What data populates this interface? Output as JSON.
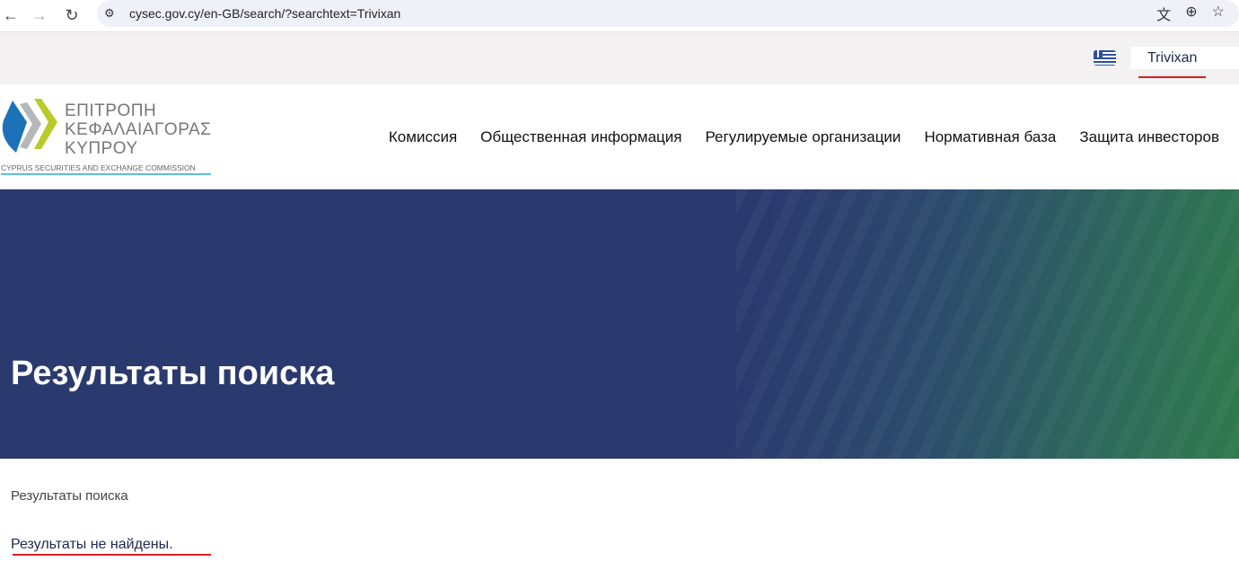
{
  "browser": {
    "url": "cysec.gov.cy/en-GB/search/?searchtext=Trivixan",
    "icons": [
      "back-icon",
      "forward-icon",
      "reload-icon",
      "site-settings-icon",
      "translate-icon",
      "zoom-icon",
      "star-icon"
    ]
  },
  "topbar": {
    "search_value": "Trivixan",
    "language_flag": "greek-flag-icon"
  },
  "logo": {
    "line1": "ΕΠΙΤΡΟΠΗ",
    "line2": "ΚΕΦΑΛΑΙΑΓΟΡΑΣ",
    "line3": "ΚΥΠΡΟΥ",
    "english": "CYPRUS SECURITIES AND EXCHANGE COMMISSION"
  },
  "nav": {
    "items": [
      {
        "label": "Комиссия"
      },
      {
        "label": "Общественная информация"
      },
      {
        "label": "Регулируемые организации"
      },
      {
        "label": "Нормативная база"
      },
      {
        "label": "Защита инвесторов"
      }
    ]
  },
  "hero": {
    "title": "Результаты поиска"
  },
  "content": {
    "breadcrumb": "Результаты поиска",
    "message": "Результаты не найдены."
  },
  "colors": {
    "hero": "#2b3a6e",
    "accent_green": "#2f7a4d",
    "underline": "#d42020"
  }
}
